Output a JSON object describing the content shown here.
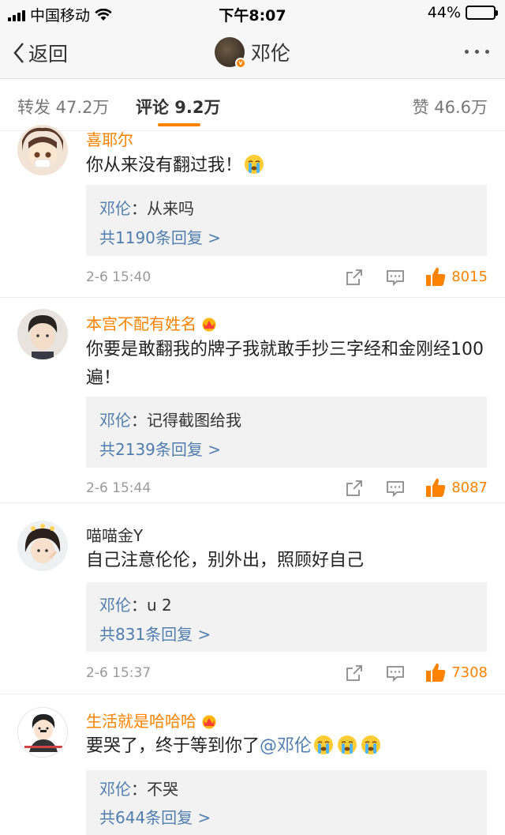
{
  "status_bar": {
    "carrier": "中国移动",
    "time": "下午8:07",
    "battery": "44%",
    "battery_level": 0.44
  },
  "nav": {
    "back_label": "返回",
    "title": "邓伦"
  },
  "tabs": [
    {
      "label": "转发 47.2万"
    },
    {
      "label": "评论 9.2万"
    },
    {
      "label": "赞 46.6万"
    }
  ],
  "comments": [
    {
      "username": "喜耶尔",
      "text": "你从来没有翻过我！",
      "reply": {
        "author": "邓伦",
        "text": "：从来吗"
      },
      "reply_count": "共1190条回复 >",
      "time": "2-6 15:40",
      "likes": "8015"
    },
    {
      "username": "本宫不配有姓名",
      "text": "你要是敢翻我的牌子我就敢手抄三字经和金刚经100遍！",
      "reply": {
        "author": "邓伦",
        "text": "：记得截图给我"
      },
      "reply_count": "共2139条回复 >",
      "time": "2-6 15:44",
      "likes": "8087"
    },
    {
      "username": "喵喵金Y",
      "text": "自己注意伦伦，别外出，照顾好自己",
      "reply": {
        "author": "邓伦",
        "text": "：u 2"
      },
      "reply_count": "共831条回复 >",
      "time": "2-6 15:37",
      "likes": "7308"
    },
    {
      "username": "生活就是哈哈哈",
      "text": "要哭了，终于等到你了",
      "mention": "@邓伦",
      "reply": {
        "author": "邓伦",
        "text": "：不哭"
      },
      "reply_count": "共644条回复 >"
    }
  ],
  "colors": {
    "accent": "#ff8200",
    "link": "#507daf"
  }
}
